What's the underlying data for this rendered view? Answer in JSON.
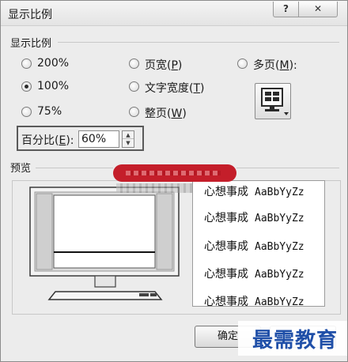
{
  "window": {
    "title": "显示比例",
    "help_label": "?",
    "close_label": "✕"
  },
  "zoom_group": {
    "label": "显示比例",
    "options": [
      {
        "label": "200%",
        "selected": false
      },
      {
        "label": "100%",
        "selected": true
      },
      {
        "label": "75%",
        "selected": false
      },
      {
        "label_text": "页宽(",
        "label_key": "P",
        "label_end": ")",
        "selected": false
      },
      {
        "label_text": "文字宽度(",
        "label_key": "T",
        "label_end": ")",
        "selected": false
      },
      {
        "label_text": "整页(",
        "label_key": "W",
        "label_end": ")",
        "selected": false
      },
      {
        "label_text": "多页(",
        "label_key": "M",
        "label_end": "):",
        "selected": false
      }
    ],
    "multi_page_icon": "multi-page-monitor-icon"
  },
  "percent": {
    "label_text": "百分比(",
    "label_key": "E",
    "label_end": "):",
    "value": "60%"
  },
  "preview": {
    "label": "预览",
    "sample_lines": [
      {
        "cjk": "心想事成",
        "latin": "AaBbYyZz"
      },
      {
        "cjk": "心想事成",
        "latin": "AaBbYyZz"
      },
      {
        "cjk": "心想事成",
        "latin": "AaBbYyZz"
      },
      {
        "cjk": "心想事成",
        "latin": "AaBbYyZz"
      },
      {
        "cjk": "心想事成",
        "latin": "AaBbYyZz"
      }
    ]
  },
  "buttons": {
    "ok_label": "确定"
  },
  "watermark": {
    "text": "最需教育"
  },
  "colors": {
    "redaction": "#c41e2a",
    "watermark": "#1f4fa8"
  }
}
